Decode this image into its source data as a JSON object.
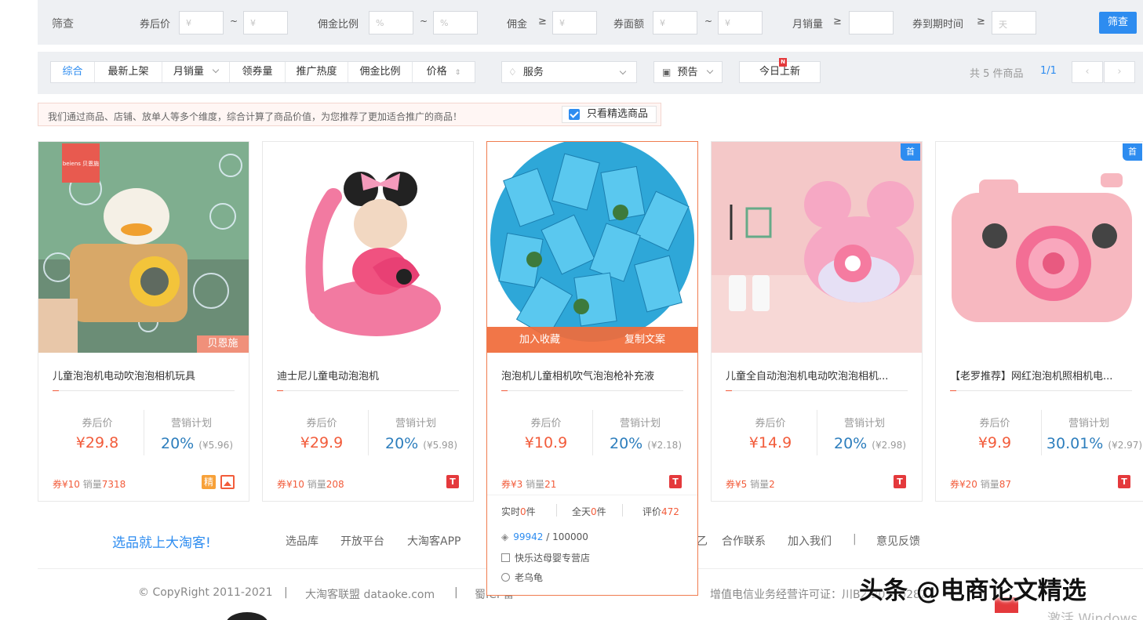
{
  "filter": {
    "title": "筛查",
    "after_coupon_label": "券后价",
    "commission_rate_label": "佣金比例",
    "commission_label": "佣金",
    "coupon_amount_label": "券面额",
    "monthly_sales_label": "月销量",
    "coupon_expire_label": "券到期时间",
    "gte": "≥",
    "tilde": "~",
    "yen_placeholder": "¥",
    "percent_placeholder": "%",
    "day_placeholder": "天",
    "submit_label": "筛查"
  },
  "sort": {
    "items": [
      "综合",
      "最新上架",
      "月销量",
      "领券量",
      "推广热度",
      "佣金比例",
      "价格"
    ],
    "service_label": "服务",
    "preview_label": "预告",
    "today_new_label": "今日上新",
    "new_badge": "N",
    "total": "共 5 件商品",
    "page": "1/1",
    "prev": "‹",
    "next": "›"
  },
  "notice": {
    "text": "我们通过商品、店铺、放单人等多个维度，综合计算了商品价值，为您推荐了更加适合推广的商品！",
    "check_label": "只看精选商品"
  },
  "labels": {
    "after_coupon": "券后价",
    "marketing": "营销计划",
    "sales_prefix": "销量",
    "t_badge": "T",
    "first_badge": "首",
    "jing_badge": "精",
    "brand_tag": "贝恩施",
    "brand_logo": "beiens 贝恩施"
  },
  "products": [
    {
      "name": "儿童泡泡机电动吹泡泡相机玩具",
      "price": "¥29.8",
      "rate": "20%",
      "commission": "(¥5.96)",
      "coupon": "券¥10",
      "sales": "7318"
    },
    {
      "name": "迪士尼儿童电动泡泡机",
      "price": "¥29.9",
      "rate": "20%",
      "commission": "(¥5.98)",
      "coupon": "券¥10",
      "sales": "208"
    },
    {
      "name": "泡泡机儿童相机吹气泡泡枪补充液",
      "price": "¥10.9",
      "rate": "20%",
      "commission": "(¥2.18)",
      "coupon": "券¥3",
      "sales": "21"
    },
    {
      "name": "儿童全自动泡泡机电动吹泡泡相机...",
      "price": "¥14.9",
      "rate": "20%",
      "commission": "(¥2.98)",
      "coupon": "券¥5",
      "sales": "2"
    },
    {
      "name": "【老罗推荐】网红泡泡机照相机电...",
      "price": "¥9.9",
      "rate": "30.01%",
      "commission": "(¥2.97)",
      "coupon": "券¥20",
      "sales": "87"
    }
  ],
  "highlight": {
    "add_fav": "加入收藏",
    "copy_text": "复制文案",
    "realtime_label": "实时",
    "realtime_value": "0",
    "allday_label": "全天",
    "allday_value": "0",
    "unit": "件",
    "review_label": "评价",
    "review_value": "472",
    "coupon_used": "99942",
    "coupon_total": "/ 100000",
    "shop": "快乐达母婴专营店",
    "seller": "老乌龟"
  },
  "footer": {
    "slogan": "选品就上大淘客!",
    "links": [
      "选品库",
      "开放平台",
      "大淘客APP"
    ],
    "links_right": [
      "合作联系",
      "加入我们",
      "意见反馈"
    ],
    "partial_char": "乙",
    "sep": "|",
    "copyright": "© CopyRight 2011-2021",
    "union": "大淘客联盟 dataoke.com",
    "icp_partial": "蜀ICP备",
    "license": "增值电信业务经营许可证：川B2-20170282",
    "watermark": "头条 @电商论文精选",
    "activate": "激活 Windows"
  },
  "colors": {
    "accent_blue": "#2d8cf0",
    "price_orange": "#f25c3b",
    "highlight_border": "#f07c4f"
  }
}
